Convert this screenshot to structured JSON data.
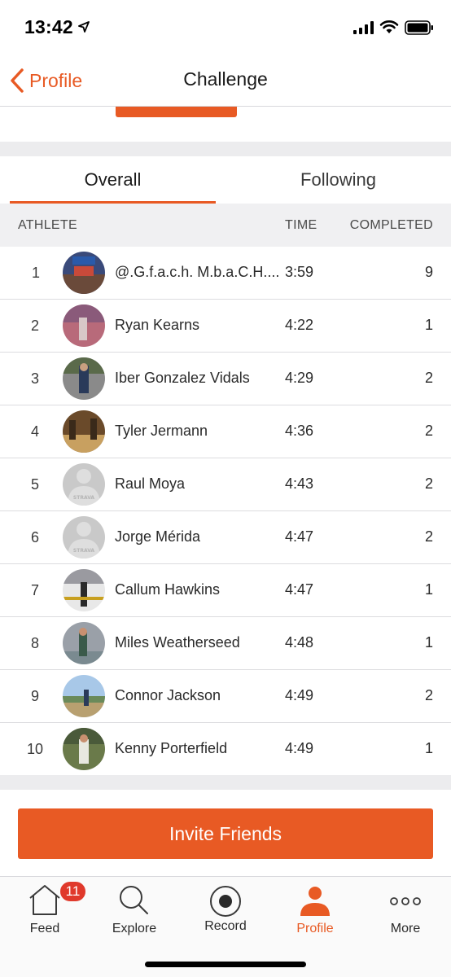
{
  "status": {
    "time": "13:42"
  },
  "nav": {
    "back_label": "Profile",
    "title": "Challenge"
  },
  "tabs": [
    {
      "label": "Overall"
    },
    {
      "label": "Following"
    }
  ],
  "table": {
    "headers": {
      "athlete": "ATHLETE",
      "time": "TIME",
      "completed": "COMPLETED"
    },
    "rows": [
      {
        "rank": "1",
        "name": "@.G.f.a.c.h. M.b.a.C.H....",
        "time": "3:59",
        "completed": "9",
        "avatar": "photo"
      },
      {
        "rank": "2",
        "name": "Ryan Kearns",
        "time": "4:22",
        "completed": "1",
        "avatar": "photo"
      },
      {
        "rank": "3",
        "name": "Iber Gonzalez Vidals",
        "time": "4:29",
        "completed": "2",
        "avatar": "photo"
      },
      {
        "rank": "4",
        "name": "Tyler Jermann",
        "time": "4:36",
        "completed": "2",
        "avatar": "photo"
      },
      {
        "rank": "5",
        "name": "Raul Moya",
        "time": "4:43",
        "completed": "2",
        "avatar": "default-strava"
      },
      {
        "rank": "6",
        "name": "Jorge Mérida",
        "time": "4:47",
        "completed": "2",
        "avatar": "default-strava"
      },
      {
        "rank": "7",
        "name": "Callum Hawkins",
        "time": "4:47",
        "completed": "1",
        "avatar": "photo"
      },
      {
        "rank": "8",
        "name": "Miles Weatherseed",
        "time": "4:48",
        "completed": "1",
        "avatar": "photo"
      },
      {
        "rank": "9",
        "name": "Connor Jackson",
        "time": "4:49",
        "completed": "2",
        "avatar": "photo"
      },
      {
        "rank": "10",
        "name": "Kenny Porterfield",
        "time": "4:49",
        "completed": "1",
        "avatar": "photo"
      }
    ]
  },
  "invite": {
    "label": "Invite Friends"
  },
  "tabbar": {
    "items": [
      {
        "label": "Feed",
        "icon": "home-icon",
        "badge": "11"
      },
      {
        "label": "Explore",
        "icon": "search-icon"
      },
      {
        "label": "Record",
        "icon": "record-icon"
      },
      {
        "label": "Profile",
        "icon": "profile-icon",
        "active": true
      },
      {
        "label": "More",
        "icon": "more-icon"
      }
    ]
  },
  "strava_placeholder": "STRAVA",
  "colors": {
    "accent": "#e85a24",
    "badge": "#e0392b"
  }
}
